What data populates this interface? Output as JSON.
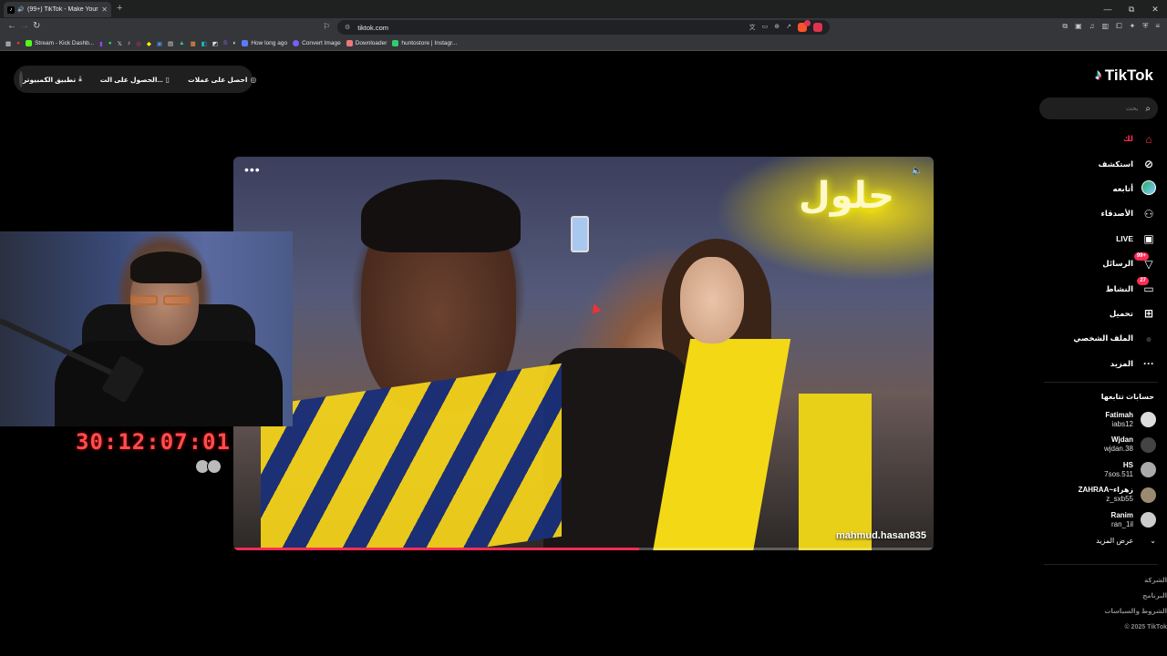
{
  "browser": {
    "tab_title": "(99+) TikTok - Make Your Day",
    "address": "tiktok.com",
    "window_controls": [
      "—",
      "⧉",
      "✕"
    ],
    "bookmarks": [
      {
        "label": "Stream - Kick Dashb...",
        "color": "#53fc18"
      },
      {
        "label": "How long ago",
        "color": "#5b7cfa"
      },
      {
        "label": "Convert Image",
        "color": "#7c5cfa"
      },
      {
        "label": "Downloader",
        "color": "#e77"
      },
      {
        "label": "huntostore | Instagr...",
        "color": "#2ecc71"
      }
    ]
  },
  "top_bar": {
    "get_coins": "احصل على عملات",
    "get_app": "الحصول على الت...",
    "pc_app": "تطبيق الكمبيوتر"
  },
  "sidebar": {
    "logo": "TikTok",
    "search_placeholder": "بحث",
    "nav": [
      {
        "label": "لك",
        "icon": "home-icon",
        "active": true
      },
      {
        "label": "استكشف",
        "icon": "compass-icon"
      },
      {
        "label": "أتابعه",
        "icon": "avatar-icon"
      },
      {
        "label": "الأصدقاء",
        "icon": "friends-icon"
      },
      {
        "label": "LIVE",
        "icon": "live-icon"
      },
      {
        "label": "الرسائل",
        "icon": "messages-icon",
        "badge": "99+"
      },
      {
        "label": "النشاط",
        "icon": "activity-icon",
        "badge": "27"
      },
      {
        "label": "تحميل",
        "icon": "upload-icon"
      },
      {
        "label": "الملف الشخصي",
        "icon": "profile-icon"
      },
      {
        "label": "المزيد",
        "icon": "more-icon"
      }
    ],
    "following_title": "حسابات تتابعها",
    "following": [
      {
        "name": "Fatimah",
        "handle": "iabs12"
      },
      {
        "name": "Wjdan",
        "handle": "wjdan.38"
      },
      {
        "name": "HS",
        "handle": "7sos.511"
      },
      {
        "name": "ZAHRAA~زهراء",
        "handle": "z_sxb55"
      },
      {
        "name": "Ranim",
        "handle": "ran_1il"
      }
    ],
    "show_more": "عرض المزيد",
    "footer": [
      "الشركة",
      "البرنامج",
      "الشروط والسياسات",
      "© 2025 TikTok"
    ]
  },
  "video": {
    "username": "mahmud.hasan835",
    "sign_text": "حلول",
    "progress": 0.58
  },
  "overlay": {
    "timer": "30:12:07:01"
  },
  "colors": {
    "accent": "#fe2c55",
    "timer": "#ff4d4d"
  }
}
